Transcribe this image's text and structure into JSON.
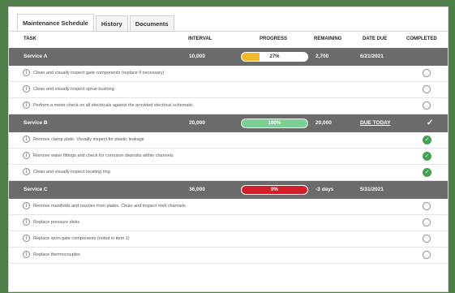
{
  "tabs": [
    {
      "label": "Maintenance Schedule",
      "active": true
    },
    {
      "label": "History",
      "active": false
    },
    {
      "label": "Documents",
      "active": false
    }
  ],
  "columns": {
    "task": "TASK",
    "interval": "INTERVAL",
    "progress": "PROGRESS",
    "remaining": "REMAINING",
    "date_due": "DATE DUE",
    "completed": "COMPLETED"
  },
  "colors": {
    "background": "#4f7d49",
    "group_header": "#6b6b6b",
    "progress_yellow": "#f3b92c",
    "progress_green": "#7ccf95",
    "progress_red": "#d01f2a",
    "complete_green": "#3fa34d"
  },
  "services": [
    {
      "name": "Service A",
      "interval": "10,000",
      "progress": "27%",
      "progress_fraction": 0.27,
      "progress_color": "yellow",
      "remaining": "2,700",
      "date_due": "6/21/2021",
      "due_is_link": false,
      "group_completed": false,
      "tasks": [
        {
          "label": "Clean and visually inspect gate components (replace if necessary)",
          "completed": false
        },
        {
          "label": "Clean and visually inspect sprue bushing",
          "completed": false
        },
        {
          "label": "Perform a meter check on all electricals against the provided electrical schematic",
          "completed": false
        }
      ]
    },
    {
      "name": "Service B",
      "interval": "20,000",
      "progress": "100%",
      "progress_fraction": 1.0,
      "progress_color": "green",
      "remaining": "20,000",
      "date_due": "DUE TODAY",
      "due_is_link": true,
      "group_completed": true,
      "tasks": [
        {
          "label": "Remove clamp plate. Visually inspect for plastic leakage",
          "completed": true
        },
        {
          "label": "Remove water fittings and check for corrosion deposits within channels",
          "completed": true
        },
        {
          "label": "Clean and visually inspect locating ring",
          "completed": true
        }
      ]
    },
    {
      "name": "Service C",
      "interval": "36,000",
      "progress": "0%",
      "progress_fraction": 0.0,
      "progress_color": "red",
      "remaining": "-3 days",
      "date_due": "5/31/2021",
      "due_is_link": false,
      "group_completed": false,
      "tasks": [
        {
          "label": "Remove manifolds and nozzles from plates. Clean and inspect melt channels",
          "completed": false
        },
        {
          "label": "Replace pressure disks",
          "completed": false
        },
        {
          "label": "Replace worn gate components (noted in item 1)",
          "completed": false
        },
        {
          "label": "Replace thermocouples",
          "completed": false
        }
      ]
    }
  ]
}
